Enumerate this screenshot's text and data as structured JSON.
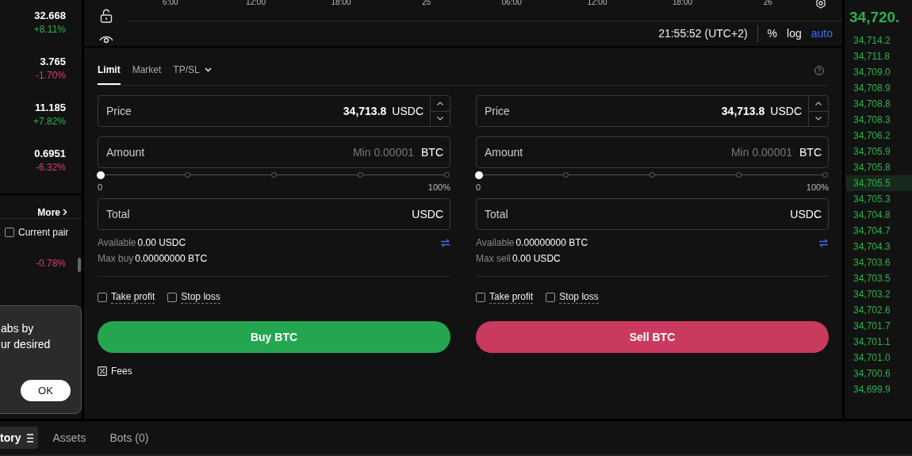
{
  "markets": [
    {
      "price": "32.668",
      "change": "+8.11%",
      "color": "#2bb24c"
    },
    {
      "price": "3.765",
      "change": "-1.70%",
      "color": "#d24667"
    },
    {
      "price": "11.185",
      "change": "+7.82%",
      "color": "#2bb24c"
    },
    {
      "price": "0.6951",
      "change": "-6.32%",
      "color": "#d24667"
    }
  ],
  "more_link": "More",
  "current_pair": {
    "label": "Current pair",
    "checked": false
  },
  "pair_change": {
    "change": "-0.78%",
    "color": "#d24667"
  },
  "tooltip": {
    "lines": [
      "abs by",
      "ur desired"
    ],
    "button": "OK"
  },
  "chart": {
    "time_axis": [
      "6:00",
      "12:00",
      "18:00",
      "25",
      "06:00",
      "12:00",
      "18:00",
      "26"
    ],
    "clock": "21:55:52 (UTC+2)",
    "options": [
      {
        "label": "%",
        "selected": false
      },
      {
        "label": "log",
        "selected": false
      },
      {
        "label": "auto",
        "selected": true
      }
    ]
  },
  "trade": {
    "tabs": [
      {
        "label": "Limit",
        "selected": true,
        "dropdown": false
      },
      {
        "label": "Market",
        "selected": false,
        "dropdown": false
      },
      {
        "label": "TP/SL",
        "selected": false,
        "dropdown": true
      }
    ],
    "columns": [
      {
        "color": "#24a651",
        "price": {
          "label": "Price",
          "value": "34,713.8",
          "unit": "USDC"
        },
        "amount": {
          "label": "Amount",
          "placeholder": "Min 0.00001",
          "unit": "BTC"
        },
        "slider": {
          "level": 0,
          "min_label": "0",
          "max_label": "100%"
        },
        "total": {
          "label": "Total",
          "unit": "USDC"
        },
        "available": {
          "label": "Available",
          "value": "0.00 USDC"
        },
        "max": {
          "label": "Max buy",
          "value": "0.00000000 BTC"
        },
        "options": [
          {
            "label": "Take profit",
            "checked": false
          },
          {
            "label": "Stop loss",
            "checked": false
          }
        ],
        "button": "Buy BTC",
        "fees": "Fees"
      },
      {
        "color": "#c93a5e",
        "price": {
          "label": "Price",
          "value": "34,713.8",
          "unit": "USDC"
        },
        "amount": {
          "label": "Amount",
          "placeholder": "Min 0.00001",
          "unit": "BTC"
        },
        "slider": {
          "level": 0,
          "min_label": "0",
          "max_label": "100%"
        },
        "total": {
          "label": "Total",
          "unit": "USDC"
        },
        "available": {
          "label": "Available",
          "value": "0.00000000 BTC"
        },
        "max": {
          "label": "Max sell",
          "value": "0.00 USDC"
        },
        "options": [
          {
            "label": "Take profit",
            "checked": false
          },
          {
            "label": "Stop loss",
            "checked": false
          }
        ],
        "button": "Sell BTC"
      }
    ]
  },
  "order_book": {
    "last_price": "34,720.",
    "rows": [
      {
        "price": "34,714.2",
        "selected": false
      },
      {
        "price": "34,711.8",
        "selected": false
      },
      {
        "price": "34,709.0",
        "selected": false
      },
      {
        "price": "34,708.9",
        "selected": false
      },
      {
        "price": "34,708.8",
        "selected": false
      },
      {
        "price": "34,708.3",
        "selected": false
      },
      {
        "price": "34,706.2",
        "selected": false
      },
      {
        "price": "34,705.9",
        "selected": false
      },
      {
        "price": "34,705.8",
        "selected": false
      },
      {
        "price": "34,705.5",
        "selected": true
      },
      {
        "price": "34,705.3",
        "selected": false
      },
      {
        "price": "34,704.8",
        "selected": false
      },
      {
        "price": "34,704.7",
        "selected": false
      },
      {
        "price": "34,704.3",
        "selected": false
      },
      {
        "price": "34,703.6",
        "selected": false
      },
      {
        "price": "34,703.5",
        "selected": false
      },
      {
        "price": "34,703.2",
        "selected": false
      },
      {
        "price": "34,702.6",
        "selected": false
      },
      {
        "price": "34,701.7",
        "selected": false
      },
      {
        "price": "34,701.1",
        "selected": false
      },
      {
        "price": "34,701.0",
        "selected": false
      },
      {
        "price": "34,700.6",
        "selected": false
      },
      {
        "price": "34,699.9",
        "selected": false
      }
    ]
  },
  "bottom_tabs": [
    {
      "label": "tory",
      "selected": true,
      "menu": true
    },
    {
      "label": "Assets",
      "selected": false,
      "menu": false
    },
    {
      "label": "Bots (0)",
      "selected": false,
      "menu": false
    }
  ]
}
